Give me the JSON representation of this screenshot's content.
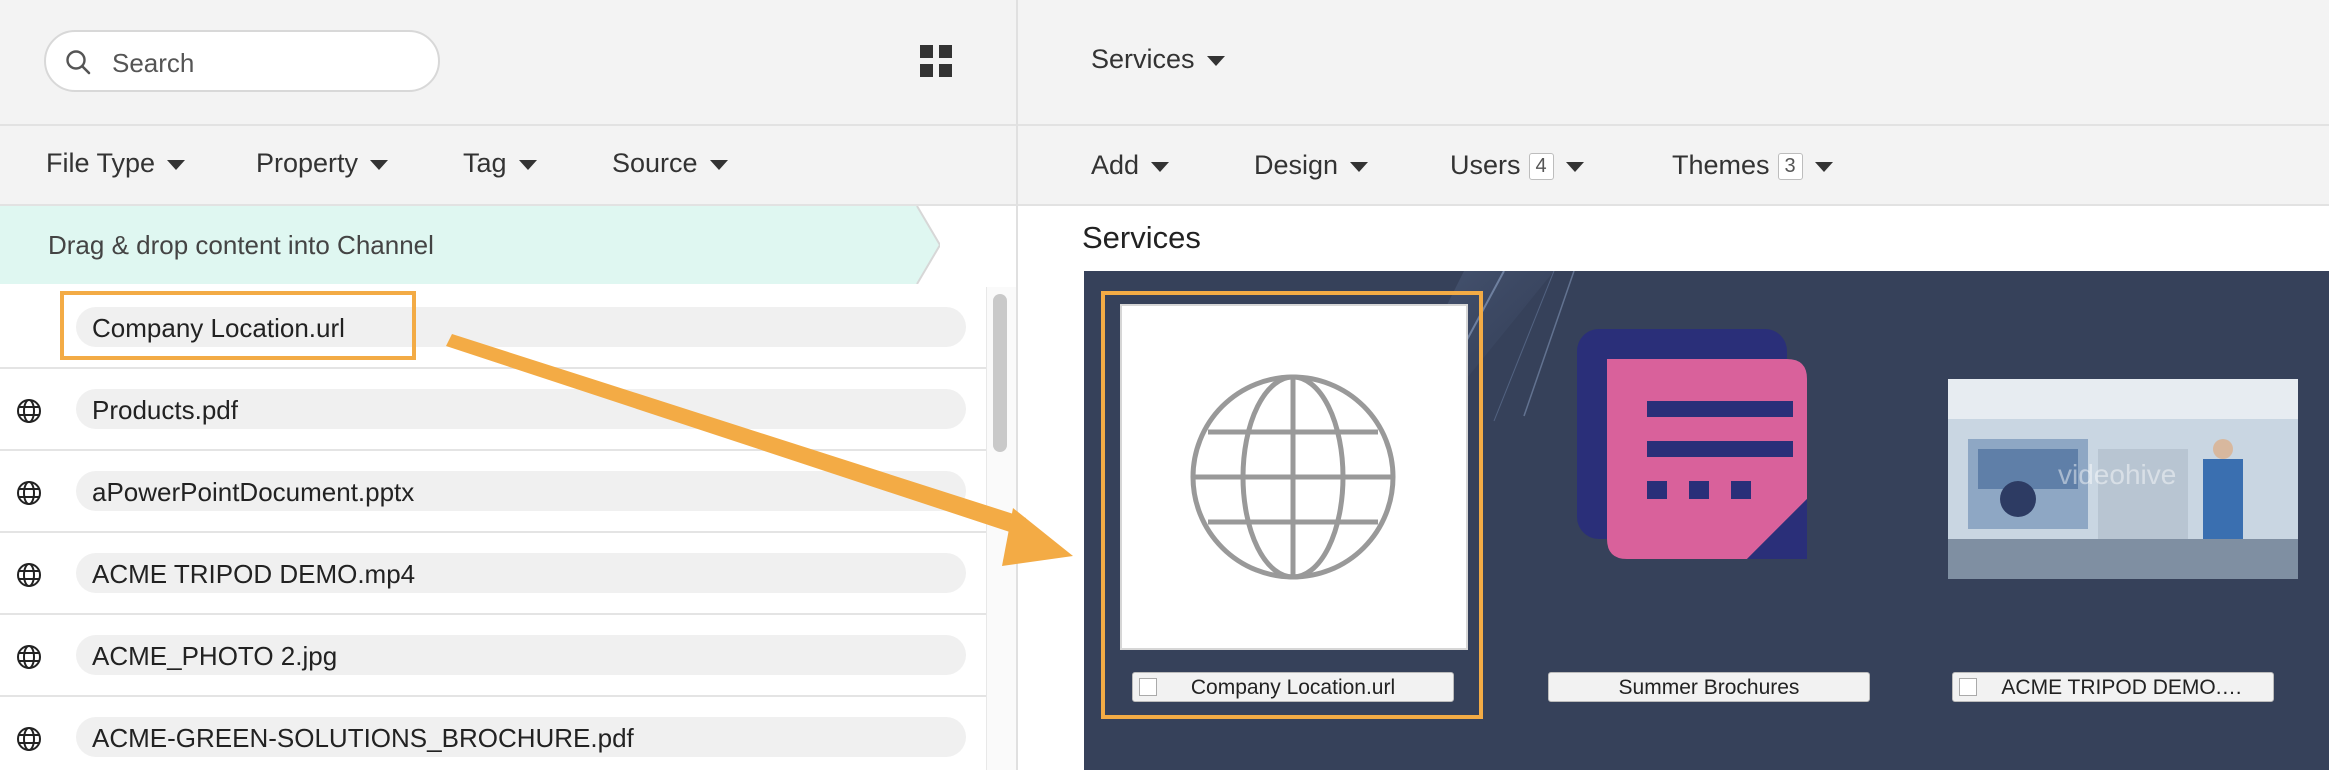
{
  "left": {
    "search": {
      "placeholder": "Search"
    },
    "filters": [
      "File Type",
      "Property",
      "Tag",
      "Source"
    ],
    "banner": "Drag & drop content into Channel",
    "files": [
      "Company Location.url",
      "Products.pdf",
      "aPowerPointDocument.pptx",
      "ACME TRIPOD DEMO.mp4",
      "ACME_PHOTO 2.jpg",
      "ACME-GREEN-SOLUTIONS_BROCHURE.pdf"
    ]
  },
  "right": {
    "channel_selector": "Services",
    "toolbar": {
      "add": "Add",
      "design": "Design",
      "users": "Users",
      "users_count": "4",
      "themes": "Themes",
      "themes_count": "3"
    },
    "section_title": "Services",
    "tiles": [
      {
        "label": "Company Location.url",
        "icon": "globe-icon"
      },
      {
        "label": "Summer Brochures",
        "icon": "document-icon"
      },
      {
        "label": "ACME TRIPOD DEMO.…",
        "icon": "video-thumbnail",
        "watermark": "videohive"
      }
    ]
  },
  "colors": {
    "highlight": "#f3ab45",
    "banner": "#dff7f1",
    "canvas": "#36415a",
    "brochure_pink": "#d9619b",
    "brochure_navy": "#2a2f79"
  }
}
